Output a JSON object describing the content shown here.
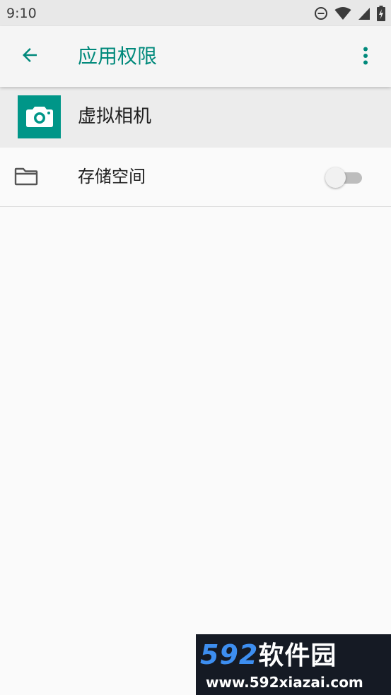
{
  "status_bar": {
    "time": "9:10",
    "icons": [
      "do-not-disturb-icon",
      "wifi-icon",
      "cell-signal-icon",
      "battery-charging-icon"
    ]
  },
  "app_bar": {
    "title": "应用权限",
    "back_icon": "arrow-left-icon",
    "overflow_icon": "more-vert-icon"
  },
  "app_header": {
    "app_name": "虚拟相机",
    "icon": "camera-icon"
  },
  "permissions": [
    {
      "label": "存储空间",
      "icon": "folder-icon",
      "enabled": false
    }
  ],
  "colors": {
    "accent": "#00897b",
    "app_icon_bg": "#009688",
    "header_bg": "#ececec",
    "background": "#fafafa"
  },
  "watermark": {
    "digits": "592",
    "brand": "软件园",
    "url": "www.592xiazai.com"
  }
}
